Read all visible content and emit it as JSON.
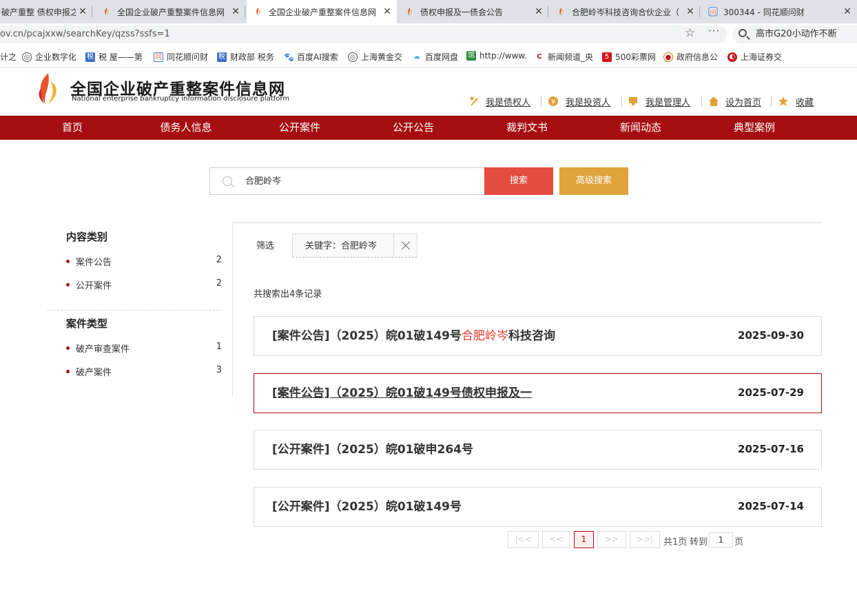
{
  "browser": {
    "tabs": [
      {
        "title": "破产重整 债权申报之"
      },
      {
        "title": "全国企业破产重整案件信息网"
      },
      {
        "title": "全国企业破产重整案件信息网"
      },
      {
        "title": "债权申报及一债会公告"
      },
      {
        "title": "合肥岭岑科技咨询合伙企业（"
      },
      {
        "title": "300344 - 同花顺问财"
      }
    ],
    "url": "ov.cn/pcajxxw/searchKey/qzss?ssfs=1",
    "search_text": "高市G20小动作不断",
    "bookmarks": [
      {
        "label": "计之",
        "icon": "folder-icon"
      },
      {
        "label": "企业数字化",
        "icon": "globe-icon"
      },
      {
        "label": "税 屋——第",
        "icon": "shuiwu-icon"
      },
      {
        "label": "同花顺问财",
        "icon": "tonghuashun-icon"
      },
      {
        "label": "财政部 税务",
        "icon": "shuiwu-icon"
      },
      {
        "label": "百度AI搜索",
        "icon": "baidu-icon"
      },
      {
        "label": "上海黄金交",
        "icon": "globe-icon"
      },
      {
        "label": "百度网盘",
        "icon": "cloud-icon"
      },
      {
        "label": "http://www.",
        "icon": "book-icon"
      },
      {
        "label": "新闻频道_央",
        "icon": "cctv-icon"
      },
      {
        "label": "500彩票网",
        "icon": "500-icon"
      },
      {
        "label": "政府信息公",
        "icon": "emblem-icon"
      },
      {
        "label": "上海证券交",
        "icon": "sse-icon"
      }
    ]
  },
  "site": {
    "name_cn": "全国企业破产重整案件信息网",
    "name_en": "National enterprise bankruptcy  information disclosure platform",
    "top_links": [
      "我是债权人",
      "我是投资人",
      "我是管理人",
      "设为首页",
      "收藏"
    ],
    "nav": [
      "首页",
      "债务人信息",
      "公开案件",
      "公开公告",
      "裁判文书",
      "新闻动态",
      "典型案例"
    ],
    "brand_color": "#a60f12"
  },
  "search": {
    "value": "合肥岭岑",
    "search_label": "搜索",
    "advanced_label": "高级搜索"
  },
  "sidebar": {
    "content_title": "内容类别",
    "content_items": [
      {
        "label": "案件公告",
        "count": "2"
      },
      {
        "label": "公开案件",
        "count": "2"
      }
    ],
    "case_title": "案件类型",
    "case_items": [
      {
        "label": "破产审查案件",
        "count": "1"
      },
      {
        "label": "破产案件",
        "count": "3"
      }
    ]
  },
  "filter": {
    "label": "筛选",
    "chip": "关键字：合肥岭岑"
  },
  "total": "共搜索出4条记录",
  "results": [
    {
      "prefix": "[案件公告]（2025）皖01破149号",
      "highlight": "合肥岭岑",
      "suffix": "科技咨询",
      "date": "2025-09-30"
    },
    {
      "prefix": "[案件公告]（2025）皖01破149号债权申报及一",
      "highlight": "",
      "suffix": "",
      "date": "2025-07-29"
    },
    {
      "prefix": "[公开案件]（2025）皖01破申264号",
      "highlight": "",
      "suffix": "",
      "date": "2025-07-16"
    },
    {
      "prefix": "[公开案件]（2025）皖01破149号",
      "highlight": "",
      "suffix": "",
      "date": "2025-07-14"
    }
  ],
  "pagination": {
    "first": "|<<",
    "prev": "<<",
    "current": "1",
    "next": ">>",
    "last": ">>|",
    "total_pages": "共1页",
    "goto": "转到",
    "goto_value": "1",
    "page_unit": "页"
  }
}
